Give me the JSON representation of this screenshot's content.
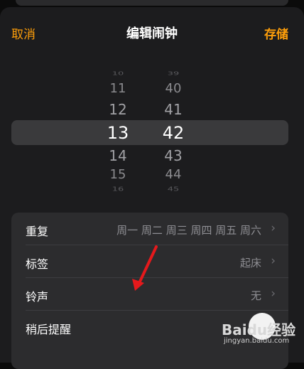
{
  "nav": {
    "cancel": "取消",
    "title": "编辑闹钟",
    "save": "存储"
  },
  "picker": {
    "hours": [
      "10",
      "11",
      "12",
      "13",
      "14",
      "15",
      "16"
    ],
    "minutes": [
      "39",
      "40",
      "41",
      "42",
      "43",
      "44",
      "45"
    ],
    "selected_hour": "13",
    "selected_minute": "42"
  },
  "settings": [
    {
      "label": "重复",
      "value": "周一 周二 周三 周四 周五 周六"
    },
    {
      "label": "标签",
      "value": "起床"
    },
    {
      "label": "铃声",
      "value": "无"
    },
    {
      "label": "稍后提醒",
      "value": ""
    }
  ],
  "colors": {
    "accent": "#ff9f0a",
    "annotation": "#e5191c"
  },
  "watermark": {
    "logo": "Baidu经验",
    "url": "jingyan.baidu.com"
  }
}
